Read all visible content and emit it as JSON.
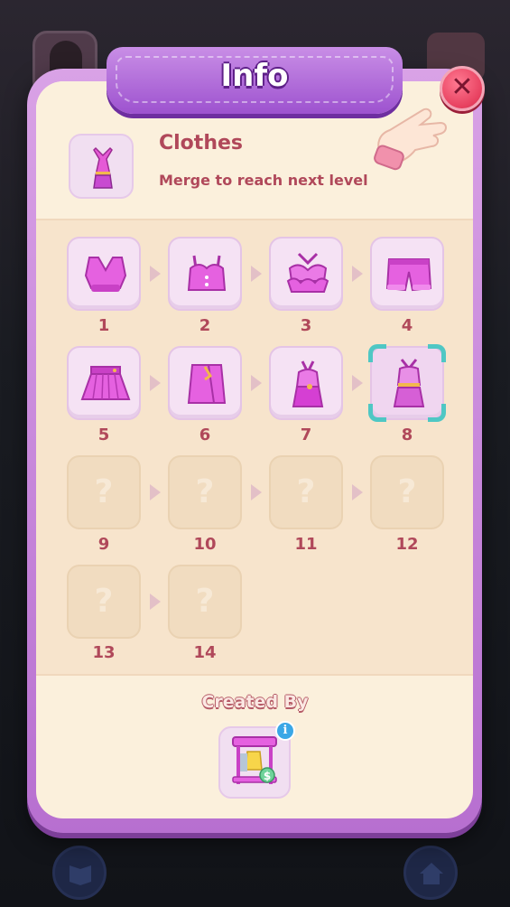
{
  "title": "Info",
  "item": {
    "name": "Clothes",
    "description": "Merge to reach next level"
  },
  "chain": [
    {
      "level": "1",
      "state": "unlocked",
      "icon": "pink-crop-top-icon"
    },
    {
      "level": "2",
      "state": "unlocked",
      "icon": "pink-bustier-top-icon"
    },
    {
      "level": "3",
      "state": "unlocked",
      "icon": "pink-ruffle-halter-top-icon"
    },
    {
      "level": "4",
      "state": "unlocked",
      "icon": "pink-shorts-icon"
    },
    {
      "level": "5",
      "state": "unlocked",
      "icon": "pink-pleated-skirt-icon"
    },
    {
      "level": "6",
      "state": "unlocked",
      "icon": "pink-wrap-skirt-icon"
    },
    {
      "level": "7",
      "state": "unlocked",
      "icon": "pink-halter-dress-icon"
    },
    {
      "level": "8",
      "state": "selected",
      "icon": "pink-belted-dress-icon"
    },
    {
      "level": "9",
      "state": "locked",
      "icon": "question-mark-icon",
      "placeholder": "?"
    },
    {
      "level": "10",
      "state": "locked",
      "icon": "question-mark-icon",
      "placeholder": "?"
    },
    {
      "level": "11",
      "state": "locked",
      "icon": "question-mark-icon",
      "placeholder": "?"
    },
    {
      "level": "12",
      "state": "locked",
      "icon": "question-mark-icon",
      "placeholder": "?"
    },
    {
      "level": "13",
      "state": "locked",
      "icon": "question-mark-icon",
      "placeholder": "?"
    },
    {
      "level": "14",
      "state": "locked",
      "icon": "question-mark-icon",
      "placeholder": "?"
    }
  ],
  "created_by": {
    "label": "Created By",
    "generator_icon": "clothes-rack-generator-icon",
    "info_glyph": "i"
  },
  "colors": {
    "accent_purple": "#9d52cf",
    "text_rose": "#b0485a",
    "panel": "#fbf0dc",
    "selection": "#4fc7c4",
    "close_red": "#e7405f"
  }
}
